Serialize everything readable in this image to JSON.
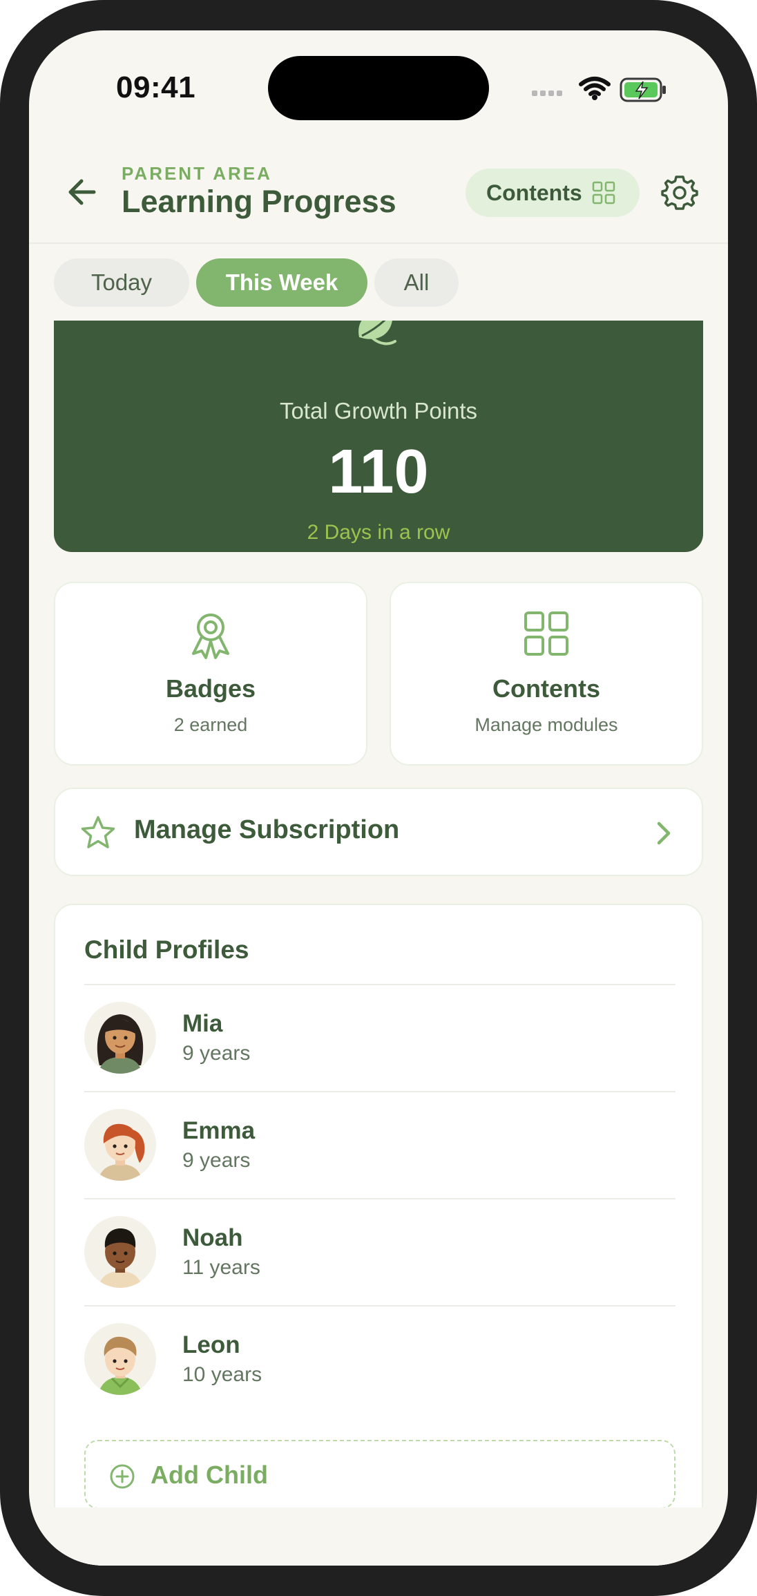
{
  "status_bar": {
    "time": "09:41"
  },
  "header": {
    "kicker": "PARENT AREA",
    "title": "Learning Progress",
    "contents_button": "Contents"
  },
  "tabs": [
    {
      "label": "Today",
      "selected": false
    },
    {
      "label": "This Week",
      "selected": true
    },
    {
      "label": "All",
      "selected": false
    }
  ],
  "summary": {
    "label": "Total Growth Points",
    "value": "110",
    "streak": "2 Days in a row"
  },
  "tiles": {
    "badges": {
      "title": "Badges",
      "subtitle": "2 earned"
    },
    "contents": {
      "title": "Contents",
      "subtitle": "Manage modules"
    }
  },
  "subscription": {
    "label": "Manage Subscription"
  },
  "profiles": {
    "title": "Child Profiles",
    "children": [
      {
        "name": "Mia",
        "age": "9 years"
      },
      {
        "name": "Emma",
        "age": "9 years"
      },
      {
        "name": "Noah",
        "age": "11 years"
      },
      {
        "name": "Leon",
        "age": "10 years"
      }
    ],
    "add_label": "Add Child"
  },
  "colors": {
    "primary_dark": "#3d5b3a",
    "accent": "#82b56e",
    "streak": "#9cc34f",
    "background": "#f7f6f1"
  }
}
